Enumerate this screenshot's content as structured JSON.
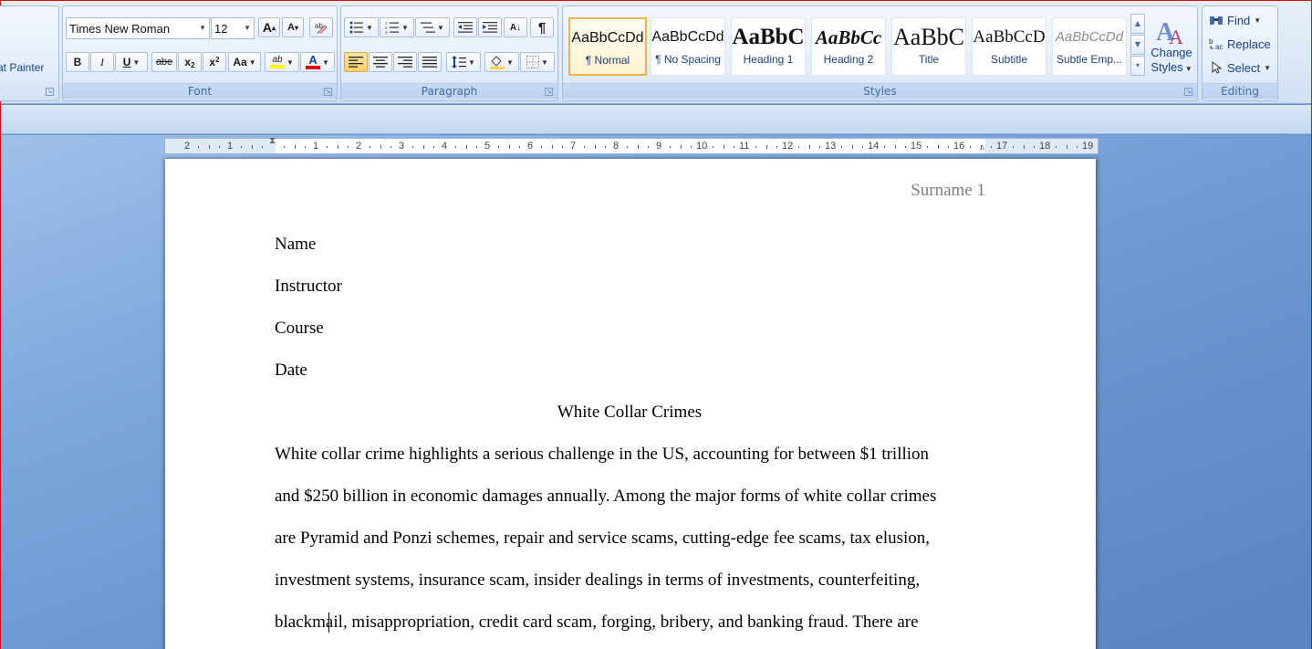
{
  "clipboard": {
    "format_painter_label": "at Painter"
  },
  "font": {
    "group_label": "Font",
    "font_name": "Times New Roman",
    "font_size": "12",
    "grow_label": "A",
    "shrink_label": "A",
    "bold_label": "B",
    "italic_label": "I",
    "underline_label": "U",
    "strike_label": "abe",
    "subscript_label": "x",
    "superscript_label": "x",
    "change_case_label": "Aa",
    "highlight_label": "ab",
    "font_color_label": "A"
  },
  "paragraph": {
    "group_label": "Paragraph",
    "sort_label": "A↓",
    "pilcrow_label": "¶"
  },
  "styles": {
    "group_label": "Styles",
    "items": [
      {
        "preview": "AaBbCcDd",
        "name": "¶ Normal"
      },
      {
        "preview": "AaBbCcDd",
        "name": "¶ No Spacing"
      },
      {
        "preview": "AaBbC",
        "name": "Heading 1"
      },
      {
        "preview": "AaBbCc",
        "name": "Heading 2"
      },
      {
        "preview": "AaBbC",
        "name": "Title"
      },
      {
        "preview": "AaBbCcD",
        "name": "Subtitle"
      },
      {
        "preview": "AaBbCcDd",
        "name": "Subtle Emp..."
      }
    ],
    "change_styles_line1": "Change",
    "change_styles_line2": "Styles"
  },
  "editing": {
    "group_label": "Editing",
    "find_label": "Find",
    "replace_label": "Replace",
    "select_label": "Select"
  },
  "ruler": {
    "labels": [
      "2",
      "1",
      "",
      "1",
      "2",
      "3",
      "4",
      "5",
      "6",
      "7",
      "8",
      "9",
      "10",
      "11",
      "12",
      "13",
      "14",
      "15",
      "16",
      "17",
      "18",
      "19"
    ]
  },
  "document": {
    "header": "Surname 1",
    "lines": [
      "Name",
      "Instructor",
      "Course",
      "Date"
    ],
    "title": "White Collar Crimes",
    "body": [
      "White collar crime highlights a serious challenge in the US, accounting for between $1 trillion",
      "and $250 billion in economic damages annually. Among the major forms of white collar crimes",
      "are Pyramid and Ponzi schemes, repair and service scams, cutting-edge fee scams, tax elusion,",
      "investment systems, insurance scam, insider dealings in terms of investments, counterfeiting,",
      "blackmail, misappropriation, credit card scam, forging, bribery, and banking fraud. There are"
    ]
  },
  "colors": {
    "highlight": "#ffff00",
    "font_color": "#e00000",
    "selected_style_border": "#e5b64a"
  }
}
